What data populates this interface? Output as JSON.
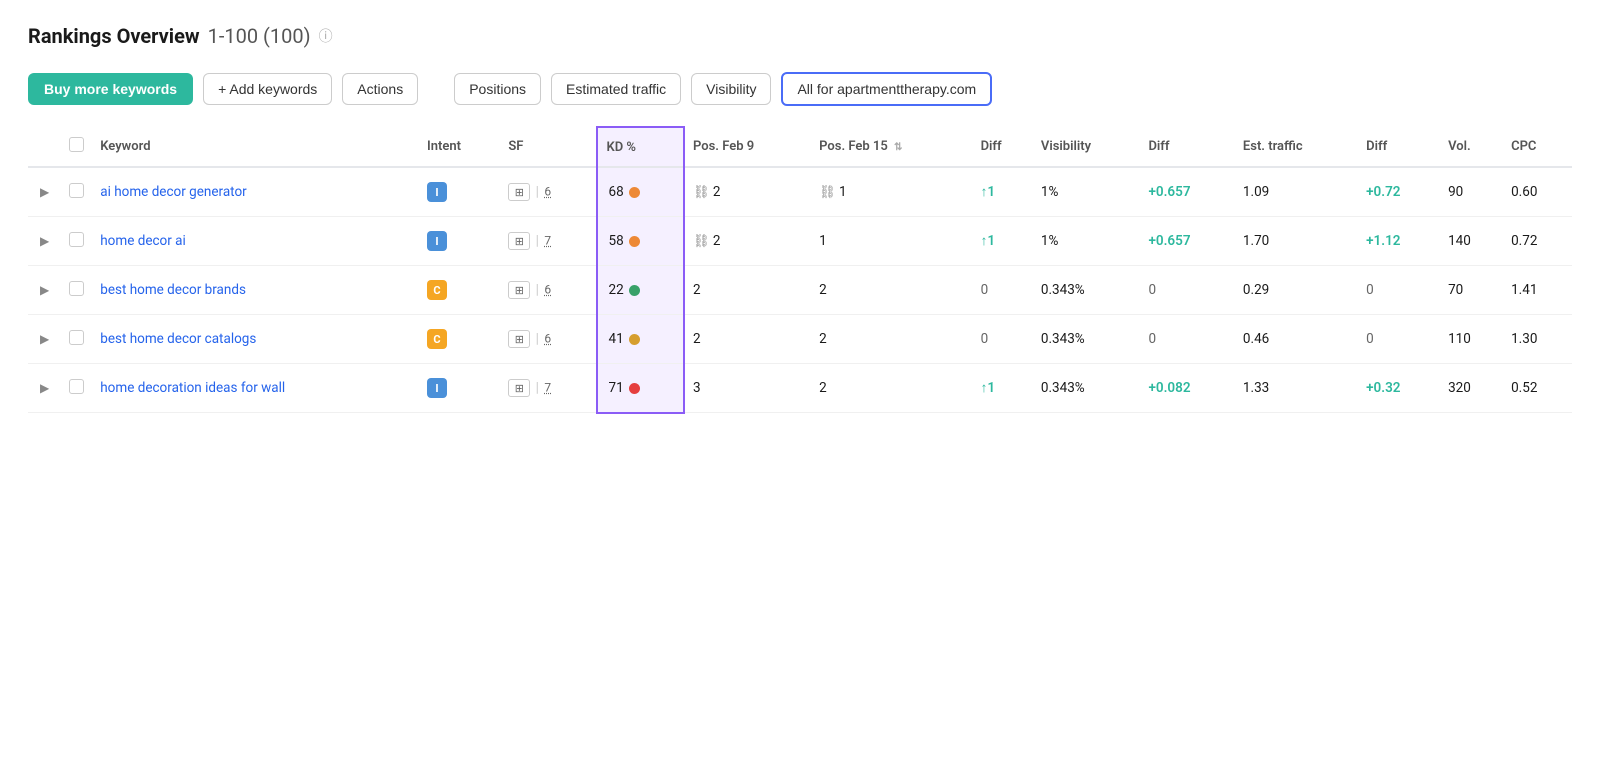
{
  "header": {
    "title": "Rankings Overview",
    "subtitle": "1-100 (100)",
    "info_icon": "ⓘ"
  },
  "toolbar": {
    "buy_keywords": "Buy more keywords",
    "add_keywords": "+ Add keywords",
    "actions": "Actions",
    "tabs": [
      "Positions",
      "Estimated traffic",
      "Visibility"
    ],
    "filter_label": "All for apartmenttherapy.com"
  },
  "table": {
    "columns": [
      {
        "id": "keyword",
        "label": "Keyword"
      },
      {
        "id": "intent",
        "label": "Intent"
      },
      {
        "id": "sf",
        "label": "SF"
      },
      {
        "id": "kd",
        "label": "KD %"
      },
      {
        "id": "pos_feb9",
        "label": "Pos. Feb 9"
      },
      {
        "id": "pos_feb15",
        "label": "Pos. Feb 15"
      },
      {
        "id": "diff",
        "label": "Diff"
      },
      {
        "id": "visibility",
        "label": "Visibility"
      },
      {
        "id": "vis_diff",
        "label": "Diff"
      },
      {
        "id": "est_traffic",
        "label": "Est. traffic"
      },
      {
        "id": "traffic_diff",
        "label": "Diff"
      },
      {
        "id": "vol",
        "label": "Vol."
      },
      {
        "id": "cpc",
        "label": "CPC"
      }
    ],
    "rows": [
      {
        "keyword": "ai home decor generator",
        "intent": "I",
        "intent_type": "i",
        "sf_num": "6",
        "kd": "68",
        "kd_color": "orange",
        "pos_feb9": "⛓ 2",
        "pos_feb15": "⛓ 1",
        "diff": "↑1",
        "diff_type": "up",
        "visibility": "1%",
        "vis_diff": "+0.657",
        "vis_diff_type": "pos",
        "est_traffic": "1.09",
        "traffic_diff": "+0.72",
        "traffic_diff_type": "pos",
        "vol": "90",
        "cpc": "0.60"
      },
      {
        "keyword": "home decor ai",
        "intent": "I",
        "intent_type": "i",
        "sf_num": "7",
        "kd": "58",
        "kd_color": "orange",
        "pos_feb9": "⛓ 2",
        "pos_feb15": "1",
        "diff": "↑1",
        "diff_type": "up",
        "visibility": "1%",
        "vis_diff": "+0.657",
        "vis_diff_type": "pos",
        "est_traffic": "1.70",
        "traffic_diff": "+1.12",
        "traffic_diff_type": "pos",
        "vol": "140",
        "cpc": "0.72"
      },
      {
        "keyword": "best home decor brands",
        "intent": "C",
        "intent_type": "c",
        "sf_num": "6",
        "kd": "22",
        "kd_color": "green",
        "pos_feb9": "2",
        "pos_feb15": "2",
        "diff": "0",
        "diff_type": "neutral",
        "visibility": "0.343%",
        "vis_diff": "0",
        "vis_diff_type": "neutral",
        "est_traffic": "0.29",
        "traffic_diff": "0",
        "traffic_diff_type": "neutral",
        "vol": "70",
        "cpc": "1.41"
      },
      {
        "keyword": "best home decor catalogs",
        "intent": "C",
        "intent_type": "c",
        "sf_num": "6",
        "kd": "41",
        "kd_color": "yellow",
        "pos_feb9": "2",
        "pos_feb15": "2",
        "diff": "0",
        "diff_type": "neutral",
        "visibility": "0.343%",
        "vis_diff": "0",
        "vis_diff_type": "neutral",
        "est_traffic": "0.46",
        "traffic_diff": "0",
        "traffic_diff_type": "neutral",
        "vol": "110",
        "cpc": "1.30"
      },
      {
        "keyword": "home decoration ideas for wall",
        "intent": "I",
        "intent_type": "i",
        "sf_num": "7",
        "kd": "71",
        "kd_color": "red",
        "pos_feb9": "3",
        "pos_feb15": "2",
        "diff": "↑1",
        "diff_type": "up",
        "visibility": "0.343%",
        "vis_diff": "+0.082",
        "vis_diff_type": "pos",
        "est_traffic": "1.33",
        "traffic_diff": "+0.32",
        "traffic_diff_type": "pos",
        "vol": "320",
        "cpc": "0.52"
      }
    ]
  }
}
